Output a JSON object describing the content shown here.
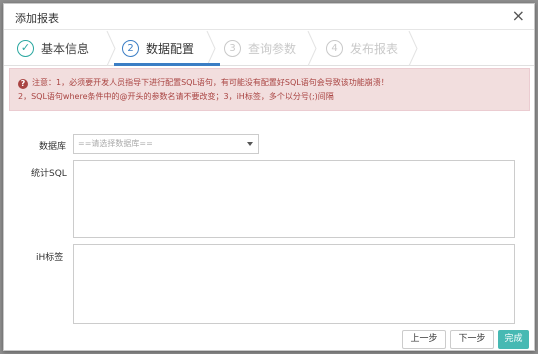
{
  "dialog": {
    "title": "添加报表",
    "close_symbol": "×"
  },
  "steps": [
    {
      "index": "✓",
      "label": "基本信息",
      "state": "done"
    },
    {
      "index": "2",
      "label": "数据配置",
      "state": "active"
    },
    {
      "index": "3",
      "label": "查询参数",
      "state": "pending"
    },
    {
      "index": "4",
      "label": "发布报表",
      "state": "pending"
    }
  ],
  "alert": {
    "icon": "?",
    "line1": "注意：1，必须要开发人员指导下进行配置SQL语句，有可能没有配置好SQL语句会导致该功能崩溃！",
    "line2": "2，SQL语句where条件中的@开头的参数名请不要改变；3，iH标签，多个以分号(;)间隔"
  },
  "form": {
    "database_label": "数据库",
    "database_placeholder": "==请选择数据库==",
    "sql_label": "统计SQL",
    "sql_value": "",
    "tag_label": "iH标签",
    "tag_value": ""
  },
  "footer": {
    "prev": "上一步",
    "next": "下一步",
    "finish": "完成"
  },
  "colors": {
    "accent": "#3b7ec5",
    "success": "#2aa7a0",
    "finish_button": "#47b9b3",
    "alert_text": "#a94442",
    "alert_bg": "#f2dede"
  }
}
